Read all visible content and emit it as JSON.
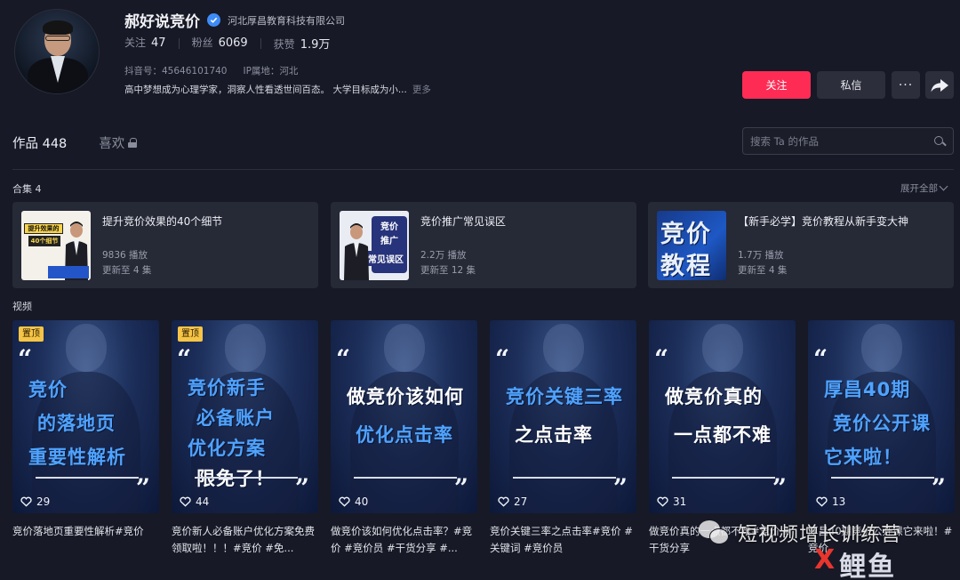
{
  "profile": {
    "name": "郝好说竞价",
    "company": "河北厚昌教育科技有限公司",
    "stats": [
      {
        "label": "关注",
        "value": "47"
      },
      {
        "label": "粉丝",
        "value": "6069"
      },
      {
        "label": "获赞",
        "value": "1.9万"
      }
    ],
    "douyin_id": "抖音号：45646101740",
    "ip_location": "IP属地：河北",
    "bio": "高中梦想成为心理学家，洞察人性看透世间百态。 大学目标成为小...",
    "bio_more": "更多"
  },
  "actions": {
    "follow": "关注",
    "message": "私信",
    "more": "···"
  },
  "tabs": {
    "works": "作品 448",
    "likes": "喜欢"
  },
  "search": {
    "placeholder": "搜索 Ta 的作品"
  },
  "collections_section": {
    "label": "合集 4",
    "expand_all": "展开全部",
    "items": [
      {
        "title": "提升竞价效果的40个细节",
        "plays": "9836 播放",
        "updated": "更新至 4 集",
        "thumb_text": [
          "提升效果的",
          "40个细节"
        ]
      },
      {
        "title": "竞价推广常见误区",
        "plays": "2.2万 播放",
        "updated": "更新至 12 集",
        "thumb_text": [
          "竞价",
          "推广",
          "常见误区"
        ]
      },
      {
        "title": "【新手必学】竞价教程从新手变大神",
        "plays": "1.7万 播放",
        "updated": "更新至 4 集",
        "thumb_text": [
          "竞价",
          "教程"
        ]
      }
    ]
  },
  "videos_section": {
    "label": "视频",
    "pin_label": "置顶",
    "items": [
      {
        "likes": "29",
        "caption": "竞价落地页重要性解析#竞价",
        "lines": [
          "竞价",
          "的落地页",
          "重要性解析"
        ],
        "colors": [
          "c-blue",
          "c-blue",
          "c-blue"
        ],
        "pinned": true
      },
      {
        "likes": "44",
        "caption": "竞价新人必备账户优化方案免费领取啦！！！#竞价 #免...",
        "lines": [
          "竞价新手",
          "必备账户",
          "优化方案",
          "限免了！"
        ],
        "colors": [
          "c-blue",
          "c-blue",
          "c-blue",
          "c-white"
        ],
        "pinned": true
      },
      {
        "likes": "40",
        "caption": "做竞价该如何优化点击率？#竞价 #竞价员 #干货分享 #...",
        "lines": [
          "做竞价该如何",
          "优化点击率"
        ],
        "colors": [
          "c-white",
          "c-blue"
        ],
        "pinned": false
      },
      {
        "likes": "27",
        "caption": "竞价关键三率之点击率#竞价 #关键词 #竞价员",
        "lines": [
          "竞价关键三率",
          "之点击率"
        ],
        "colors": [
          "c-blue",
          "c-white"
        ],
        "pinned": false
      },
      {
        "likes": "31",
        "caption": "做竞价真的一点都不难#竞价 #干货分享",
        "lines": [
          "做竞价真的",
          "一点都不难"
        ],
        "colors": [
          "c-white",
          "c-white"
        ],
        "pinned": false
      },
      {
        "likes": "13",
        "caption": "厚昌40期竞价公开课它来啦！#竞价",
        "lines": [
          "厚昌40期",
          "竞价公开课",
          "它来啦！"
        ],
        "colors": [
          "c-blue",
          "c-blue",
          "c-blue"
        ],
        "pinned": false
      }
    ]
  },
  "watermark": {
    "text": "短视频增长训练营",
    "logo_x": "X",
    "logo_rest": "鲤鱼"
  }
}
